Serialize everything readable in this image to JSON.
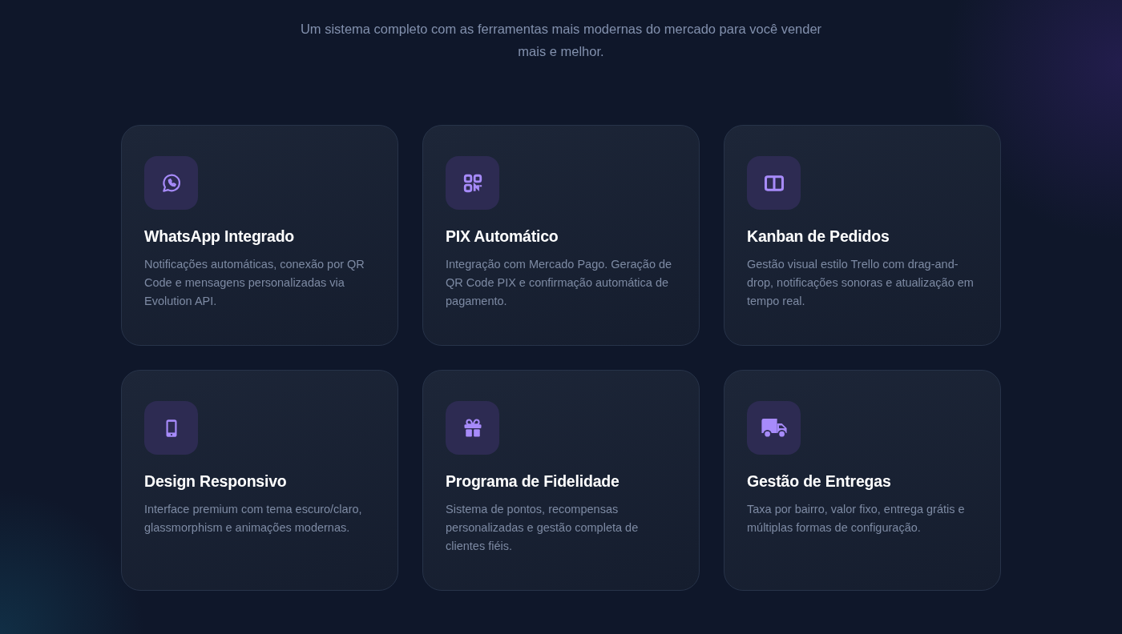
{
  "section": {
    "subtitle": "Um sistema completo com as ferramentas mais modernas do mercado para você vender mais e melhor."
  },
  "features": [
    {
      "title": "WhatsApp Integrado",
      "description": "Notificações automáticas, conexão por QR Code e mensagens personalizadas via Evolution API."
    },
    {
      "title": "PIX Automático",
      "description": "Integração com Mercado Pago. Geração de QR Code PIX e confirmação automática de pagamento."
    },
    {
      "title": "Kanban de Pedidos",
      "description": "Gestão visual estilo Trello com drag-and-drop, notificações sonoras e atualização em tempo real."
    },
    {
      "title": "Design Responsivo",
      "description": "Interface premium com tema escuro/claro, glassmorphism e animações modernas."
    },
    {
      "title": "Programa de Fidelidade",
      "description": "Sistema de pontos, recompensas personalizadas e gestão completa de clientes fiéis."
    },
    {
      "title": "Gestão de Entregas",
      "description": "Taxa por bairro, valor fixo, entrega grátis e múltiplas formas de configuração."
    }
  ]
}
